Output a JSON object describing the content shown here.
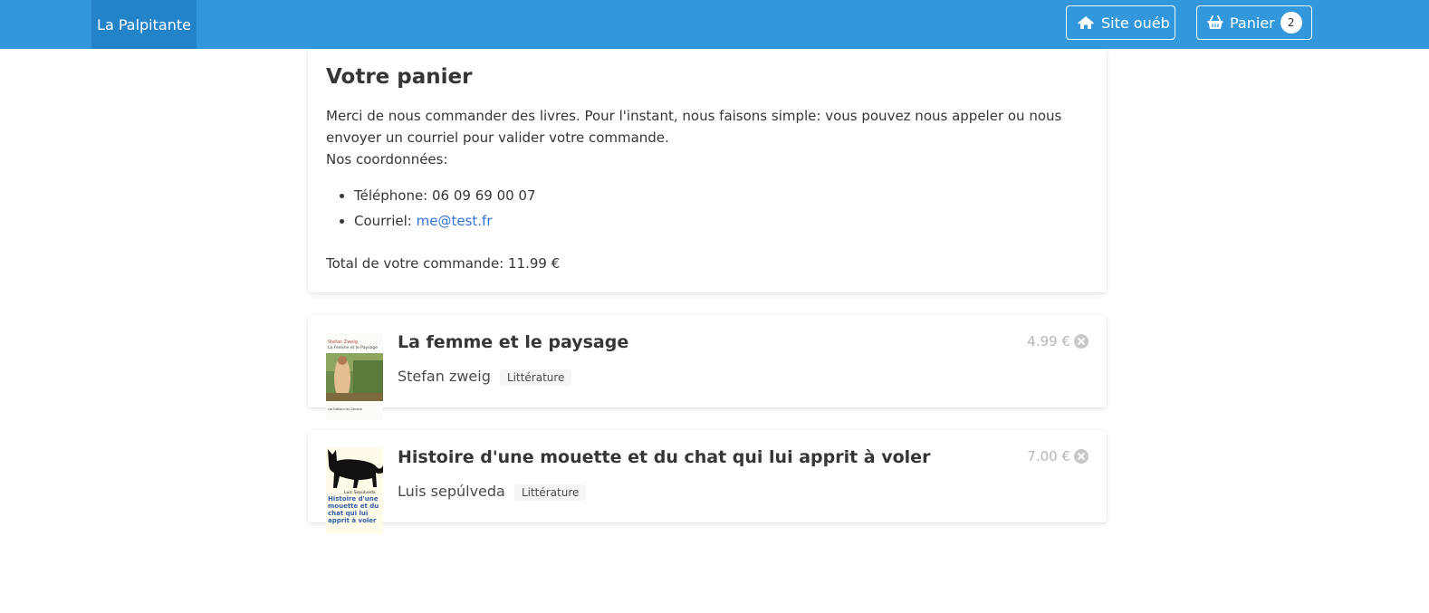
{
  "navbar": {
    "brand": "La Palpitante",
    "site_label": "Site ouéb",
    "cart_label": "Panier",
    "cart_count": "2",
    "color": "#3297db"
  },
  "cart": {
    "title": "Votre panier",
    "intro": "Merci de nous commander des livres. Pour l'instant, nous faisons simple: vous pouvez nous appeler ou nous envoyer un courriel pour valider votre commande.",
    "coords_label": "Nos coordonnées:",
    "phone_label": "Téléphone: 06 09 69 00 07",
    "email_label": "Courriel: ",
    "email": "me@test.fr",
    "total": "Total de votre commande: 11.99 €"
  },
  "books": [
    {
      "title": "La femme et le paysage",
      "author": "Stefan zweig",
      "tag": "Littérature",
      "price": "4.99 €",
      "cover_author": "Stefan Zweig",
      "cover_title": "La Femme et le Paysage",
      "cover_publisher": "Les Éditions du Cénacle"
    },
    {
      "title": "Histoire d'une mouette et du chat qui lui apprit à voler",
      "author": "Luis sepúlveda",
      "tag": "Littérature",
      "price": "7.00 €",
      "cover_author": "Luis Sepúlveda",
      "cover_title": "Histoire d'une mouette et du chat qui lui apprit à voler"
    }
  ]
}
